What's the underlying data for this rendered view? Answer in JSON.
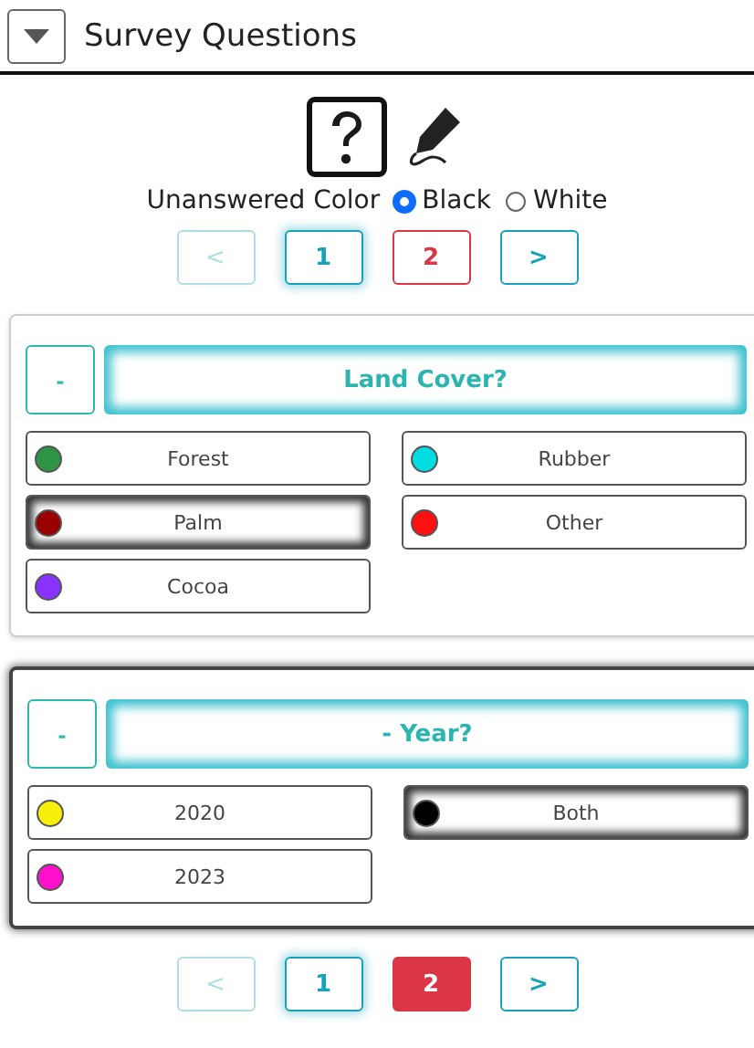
{
  "header": {
    "title": "Survey Questions",
    "expanded": true
  },
  "toolbar": {
    "help_selected": true
  },
  "unanswered_color": {
    "label": "Unanswered Color",
    "options": [
      {
        "label": "Black",
        "selected": true
      },
      {
        "label": "White",
        "selected": false
      }
    ]
  },
  "pager_top": [
    {
      "label": "<",
      "kind": "prev",
      "disabled": true,
      "selected": false,
      "filled": false
    },
    {
      "label": "1",
      "kind": "page",
      "disabled": false,
      "selected": true,
      "filled": false
    },
    {
      "label": "2",
      "kind": "page-alert",
      "disabled": false,
      "selected": false,
      "filled": false
    },
    {
      "label": ">",
      "kind": "next",
      "disabled": false,
      "selected": false,
      "filled": false
    }
  ],
  "questions": [
    {
      "collapse": "-",
      "title": "Land Cover?",
      "active": false,
      "answers": [
        {
          "label": "Forest",
          "color": "#2e9444",
          "selected": false
        },
        {
          "label": "Rubber",
          "color": "#00dce0",
          "selected": false
        },
        {
          "label": "Palm",
          "color": "#990000",
          "selected": true
        },
        {
          "label": "Other",
          "color": "#ff1010",
          "selected": false
        },
        {
          "label": "Cocoa",
          "color": "#8833ff",
          "selected": false
        }
      ]
    },
    {
      "collapse": "-",
      "title": "- Year?",
      "active": true,
      "answers": [
        {
          "label": "2020",
          "color": "#f8f00a",
          "selected": false
        },
        {
          "label": "Both",
          "color": "#000000",
          "selected": true
        },
        {
          "label": "2023",
          "color": "#ff10cc",
          "selected": false
        }
      ]
    }
  ],
  "pager_bottom": [
    {
      "label": "<",
      "kind": "prev",
      "disabled": true,
      "selected": false,
      "filled": false
    },
    {
      "label": "1",
      "kind": "page",
      "disabled": false,
      "selected": true,
      "filled": false
    },
    {
      "label": "2",
      "kind": "page-alert",
      "disabled": false,
      "selected": false,
      "filled": true
    },
    {
      "label": ">",
      "kind": "next",
      "disabled": false,
      "selected": false,
      "filled": false
    }
  ]
}
